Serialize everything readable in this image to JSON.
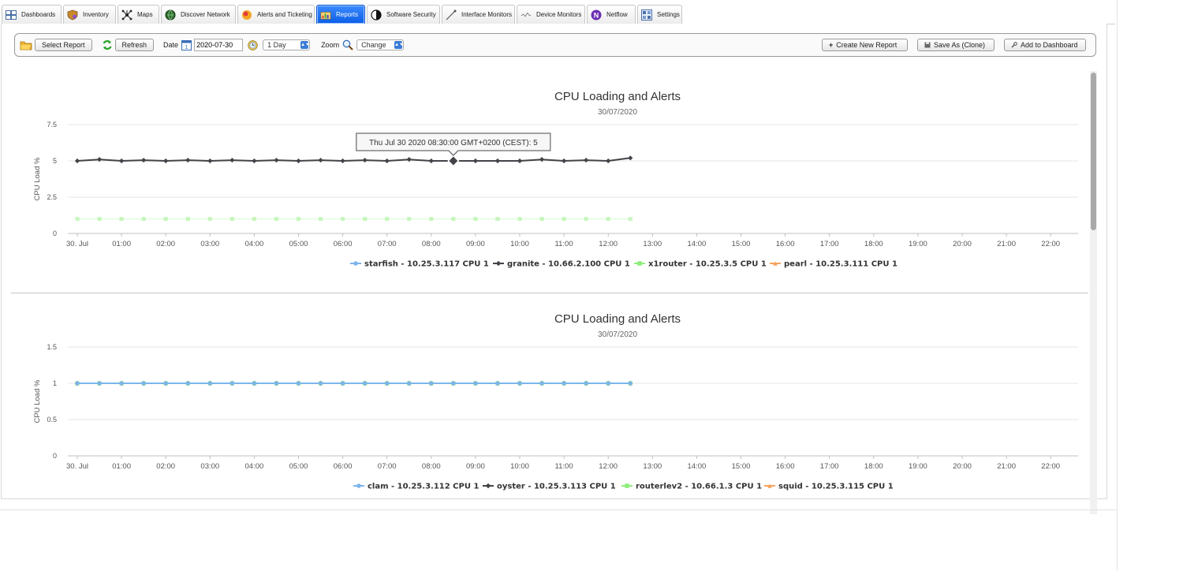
{
  "tabs": [
    {
      "label": "Dashboards",
      "icon": "dashboard-grid-icon",
      "active": false
    },
    {
      "label": "Inventory",
      "icon": "inventory-shield-icon",
      "active": false
    },
    {
      "label": "Maps",
      "icon": "network-map-icon",
      "active": false
    },
    {
      "label": "Discover Network",
      "icon": "discover-globe-icon",
      "active": false
    },
    {
      "label": "Alerts and Ticketing",
      "icon": "alert-circle-icon",
      "active": false
    },
    {
      "label": "Reports",
      "icon": "reports-chart-icon",
      "active": true
    },
    {
      "label": "Software Security",
      "icon": "security-half-circle-icon",
      "active": false
    },
    {
      "label": "Interface Monitors",
      "icon": "interface-line-icon",
      "active": false
    },
    {
      "label": "Device Monitors",
      "icon": "device-monitor-icon",
      "active": false
    },
    {
      "label": "Netflow",
      "icon": "netflow-n-icon",
      "active": false
    },
    {
      "label": "Settings",
      "icon": "settings-grid-icon",
      "active": false
    }
  ],
  "toolbar": {
    "select_report": "Select Report",
    "refresh": "Refresh",
    "date_label": "Date",
    "date_value": "2020-07-30",
    "period": "1 Day",
    "zoom_label": "Zoom",
    "zoom_value": "Change",
    "create_new": "Create New Report",
    "save_as": "Save As (Clone)",
    "add_dashboard": "Add to Dashboard"
  },
  "chart_data": [
    {
      "type": "line",
      "title": "CPU Loading and Alerts",
      "subtitle": "30/07/2020",
      "ylabel": "CPU Load %",
      "xlabel": "",
      "ylim": [
        0,
        7.5
      ],
      "y_ticks": [
        "0",
        "2.5",
        "5",
        "7.5"
      ],
      "x_ticks": [
        "30. Jul",
        "01:00",
        "02:00",
        "03:00",
        "04:00",
        "05:00",
        "06:00",
        "07:00",
        "08:00",
        "09:00",
        "10:00",
        "11:00",
        "12:00",
        "13:00",
        "14:00",
        "15:00",
        "16:00",
        "17:00",
        "18:00",
        "19:00",
        "20:00",
        "21:00",
        "22:00"
      ],
      "x_hours": [
        0,
        0.5,
        1,
        1.5,
        2,
        2.5,
        3,
        3.5,
        4,
        4.5,
        5,
        5.5,
        6,
        6.5,
        7,
        7.5,
        8,
        8.5,
        9,
        9.5,
        10,
        10.5,
        11,
        11.5,
        12,
        12.5
      ],
      "grid": true,
      "legend": "bottom",
      "series": [
        {
          "name": "starfish - 10.25.3.117 CPU 1",
          "color": "#7cb5ec",
          "marker": "circle",
          "values": []
        },
        {
          "name": "granite - 10.66.2.100 CPU 1",
          "color": "#434348",
          "marker": "diamond",
          "values": [
            5,
            5.1,
            5,
            5.05,
            5,
            5.05,
            5,
            5.05,
            5,
            5.05,
            5,
            5.05,
            5,
            5.05,
            5,
            5.1,
            5,
            5,
            5,
            5,
            5,
            5.1,
            5,
            5.05,
            5,
            5.2
          ]
        },
        {
          "name": "x1router - 10.25.3.5 CPU 1",
          "color": "#90ed7d",
          "marker": "square",
          "values": [
            1,
            1,
            1,
            1,
            1,
            1,
            1,
            1,
            1,
            1,
            1,
            1,
            1,
            1,
            1,
            1,
            1,
            1,
            1,
            1,
            1,
            1,
            1,
            1,
            1,
            1
          ]
        },
        {
          "name": "pearl - 10.25.3.111 CPU 1",
          "color": "#f7a35c",
          "marker": "triangle",
          "values": []
        }
      ],
      "tooltip": {
        "text": "Thu Jul 30 2020 08:30:00 GMT+0200 (CEST): 5",
        "series": "granite - 10.66.2.100 CPU 1",
        "x_hour": 8.5,
        "y": 5
      }
    },
    {
      "type": "line",
      "title": "CPU Loading and Alerts",
      "subtitle": "30/07/2020",
      "ylabel": "CPU Load %",
      "xlabel": "",
      "ylim": [
        0,
        1.5
      ],
      "y_ticks": [
        "0",
        "0.5",
        "1",
        "1.5"
      ],
      "x_ticks": [
        "30. Jul",
        "01:00",
        "02:00",
        "03:00",
        "04:00",
        "05:00",
        "06:00",
        "07:00",
        "08:00",
        "09:00",
        "10:00",
        "11:00",
        "12:00",
        "13:00",
        "14:00",
        "15:00",
        "16:00",
        "17:00",
        "18:00",
        "19:00",
        "20:00",
        "21:00",
        "22:00"
      ],
      "x_hours": [
        0,
        0.5,
        1,
        1.5,
        2,
        2.5,
        3,
        3.5,
        4,
        4.5,
        5,
        5.5,
        6,
        6.5,
        7,
        7.5,
        8,
        8.5,
        9,
        9.5,
        10,
        10.5,
        11,
        11.5,
        12,
        12.5
      ],
      "grid": true,
      "legend": "bottom",
      "series": [
        {
          "name": "clam - 10.25.3.112 CPU 1",
          "color": "#7cb5ec",
          "marker": "circle",
          "values": [
            1,
            1,
            1,
            1,
            1,
            1,
            1,
            1,
            1,
            1,
            1,
            1,
            1,
            1,
            1,
            1,
            1,
            1,
            1,
            1,
            1,
            1,
            1,
            1,
            1,
            1
          ]
        },
        {
          "name": "oyster - 10.25.3.113 CPU 1",
          "color": "#434348",
          "marker": "diamond",
          "values": [
            1,
            1,
            1,
            1,
            1,
            1,
            1,
            1,
            1,
            1,
            1,
            1,
            1,
            1,
            1,
            1,
            1,
            1,
            1,
            1,
            1,
            1,
            1,
            1,
            1,
            1
          ]
        },
        {
          "name": "routerlev2 - 10.66.1.3 CPU 1",
          "color": "#90ed7d",
          "marker": "square",
          "values": [
            1,
            1,
            1,
            1,
            1,
            1,
            1,
            1,
            1,
            1,
            1,
            1,
            1,
            1,
            1,
            1,
            1,
            1,
            1,
            1,
            1,
            1,
            1,
            1,
            1,
            1
          ]
        },
        {
          "name": "squid - 10.25.3.115 CPU 1",
          "color": "#f7a35c",
          "marker": "triangle",
          "values": [
            1,
            1,
            1,
            1,
            1,
            1,
            1,
            1,
            1,
            1,
            1,
            1,
            1,
            1,
            1,
            1,
            1,
            1,
            1,
            1,
            1,
            1,
            1,
            1,
            1,
            1
          ]
        }
      ]
    }
  ]
}
